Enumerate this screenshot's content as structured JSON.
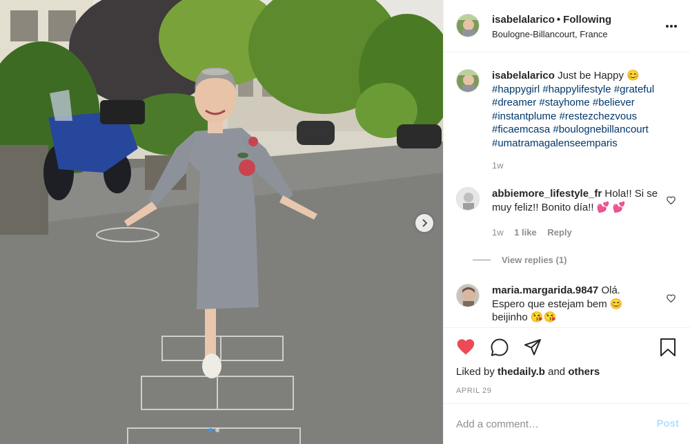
{
  "post": {
    "username": "isabelalarico",
    "follow_state": "Following",
    "location": "Boulogne-Billancourt, France",
    "caption": {
      "username": "isabelalarico",
      "text": "Just be Happy 😊",
      "hashtags_line1": "#happygirl #happylifestyle #grateful",
      "hashtags_line2": "#dreamer #stayhome #believer",
      "hashtags_line3": "#instantplume #restezchezvous",
      "hashtags_line4": "#ficaemcasa #boulognebillancourt",
      "hashtags_line5": "#umatramagalenseemparis",
      "time": "1w"
    },
    "comments": [
      {
        "username": "abbiemore_lifestyle_fr",
        "text_line1": "Hola!! Si se",
        "text_line2": "muy feliz!! Bonito día!! 💕 💕",
        "time": "1w",
        "likes": "1 like",
        "reply_label": "Reply",
        "view_replies": "View replies (1)"
      },
      {
        "username": "maria.margarida.9847",
        "text_line1": "Olá.",
        "text_line2": "Espero que estejam bem 😊",
        "text_line3": "beijinho 😘😘"
      }
    ],
    "liked_by_prefix": "Liked by",
    "liked_by_user": "thedaily.b",
    "liked_by_and": "and",
    "liked_by_others": "others",
    "date": "APRIL 29",
    "add_comment_placeholder": "Add a comment…",
    "post_button": "Post",
    "carousel": {
      "slides": 2,
      "active": 1
    }
  },
  "colors": {
    "like_red": "#ed4956",
    "hashtag_blue": "#00376b",
    "post_disabled": "#b2dffc",
    "carousel_active": "#3897f0"
  },
  "icons": [
    "more-icon",
    "heart-icon",
    "comment-icon",
    "share-icon",
    "bookmark-icon",
    "chevron-right-icon"
  ]
}
